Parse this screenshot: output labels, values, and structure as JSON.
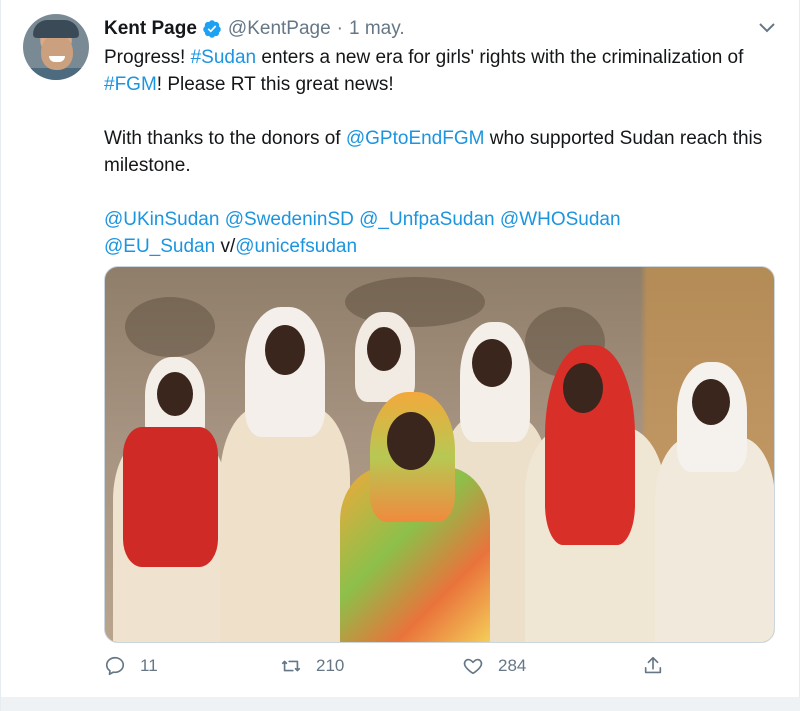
{
  "tweet": {
    "author_name": "Kent Page",
    "handle": "@KentPage",
    "separator": "·",
    "date": "1 may.",
    "verified": true,
    "line1": {
      "t1": "Progress! ",
      "tag1": "#Sudan",
      "t2": " enters a new era for girls' rights with the criminalization of ",
      "tag2": "#FGM",
      "t3": "! Please RT this great news!"
    },
    "line2": {
      "t1": "With thanks to the donors of ",
      "mention": "@GPtoEndFGM",
      "t2": " who supported Sudan reach this milestone."
    },
    "line3": {
      "m1": "@UKinSudan",
      "m2": "@SwedeninSD",
      "m3": "@_UnfpaSudan",
      "m4": "@WHOSudan",
      "m5": "@EU_Sudan",
      "t1": " v/",
      "m6": "@unicefsudan"
    }
  },
  "actions": {
    "reply_count": "11",
    "retweet_count": "210",
    "like_count": "284"
  },
  "icons": {
    "verified": "verified-badge-icon",
    "more": "chevron-down-icon",
    "reply": "reply-icon",
    "retweet": "retweet-icon",
    "like": "heart-icon",
    "share": "share-icon"
  },
  "colors": {
    "link": "#1b95e0",
    "muted": "#657786",
    "verified": "#1da1f2"
  }
}
